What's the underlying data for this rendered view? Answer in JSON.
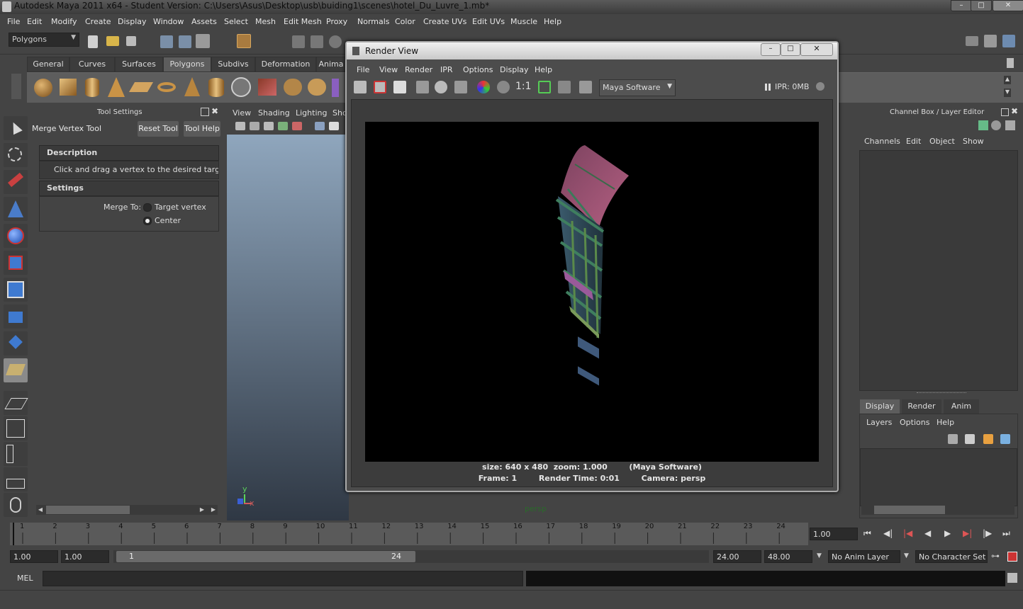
{
  "window": {
    "title": "Autodesk Maya 2011 x64 - Student Version: C:\\Users\\Asus\\Desktop\\usb\\buiding1\\scenes\\hotel_Du_Luvre_1.mb*"
  },
  "main_menu": [
    "File",
    "Edit",
    "Modify",
    "Create",
    "Display",
    "Window",
    "Assets",
    "Select",
    "Mesh",
    "Edit Mesh",
    "Proxy",
    "Normals",
    "Color",
    "Create UVs",
    "Edit UVs",
    "Muscle",
    "Help"
  ],
  "status_line": {
    "menu_set": "Polygons"
  },
  "shelf": {
    "tabs": [
      "General",
      "Curves",
      "Surfaces",
      "Polygons",
      "Subdivs",
      "Deformation",
      "Anima"
    ],
    "active_tab": "Polygons"
  },
  "tool_settings": {
    "panel_title": "Tool Settings",
    "tool_name": "Merge Vertex Tool",
    "reset_button": "Reset Tool",
    "help_button": "Tool Help",
    "description_header": "Description",
    "description_text": "Click and drag a vertex to the desired target. Al",
    "settings_header": "Settings",
    "merge_to_label": "Merge To:",
    "options": [
      {
        "label": "Target vertex",
        "selected": false
      },
      {
        "label": "Center",
        "selected": true
      }
    ]
  },
  "viewport": {
    "menu": [
      "View",
      "Shading",
      "Lighting",
      "Sho"
    ],
    "camera_label": "persp",
    "axis_y": "y",
    "axis_x": "x"
  },
  "render_view": {
    "title": "Render View",
    "menu": [
      "File",
      "View",
      "Render",
      "IPR",
      "Options",
      "Display",
      "Help"
    ],
    "ratio_label": "1:1",
    "renderer": "Maya Software",
    "ipr_label": "IPR: 0MB",
    "info_line1": "size: 640 x 480  zoom: 1.000        (Maya Software)",
    "info_line2": "Frame: 1        Render Time: 0:01        Camera: persp"
  },
  "channel_box": {
    "title": "Channel Box / Layer Editor",
    "menu": [
      "Channels",
      "Edit",
      "Object",
      "Show"
    ],
    "layer_tabs": [
      "Display",
      "Render",
      "Anim"
    ],
    "active_layer_tab": "Display",
    "layer_menu": [
      "Layers",
      "Options",
      "Help"
    ]
  },
  "timeline": {
    "ticks": [
      "1",
      "2",
      "3",
      "4",
      "5",
      "6",
      "7",
      "8",
      "9",
      "10",
      "11",
      "12",
      "13",
      "14",
      "15",
      "16",
      "17",
      "18",
      "19",
      "20",
      "21",
      "22",
      "23",
      "24"
    ],
    "current_frame": "1.00"
  },
  "range_slider": {
    "start": "1.00",
    "anim_start": "1.00",
    "range_start_label": "1",
    "range_end_label": "24",
    "range_end": "24.00",
    "anim_end": "48.00",
    "anim_layer": "No Anim Layer",
    "character_set": "No Character Set"
  },
  "command_line": {
    "mode": "MEL"
  }
}
